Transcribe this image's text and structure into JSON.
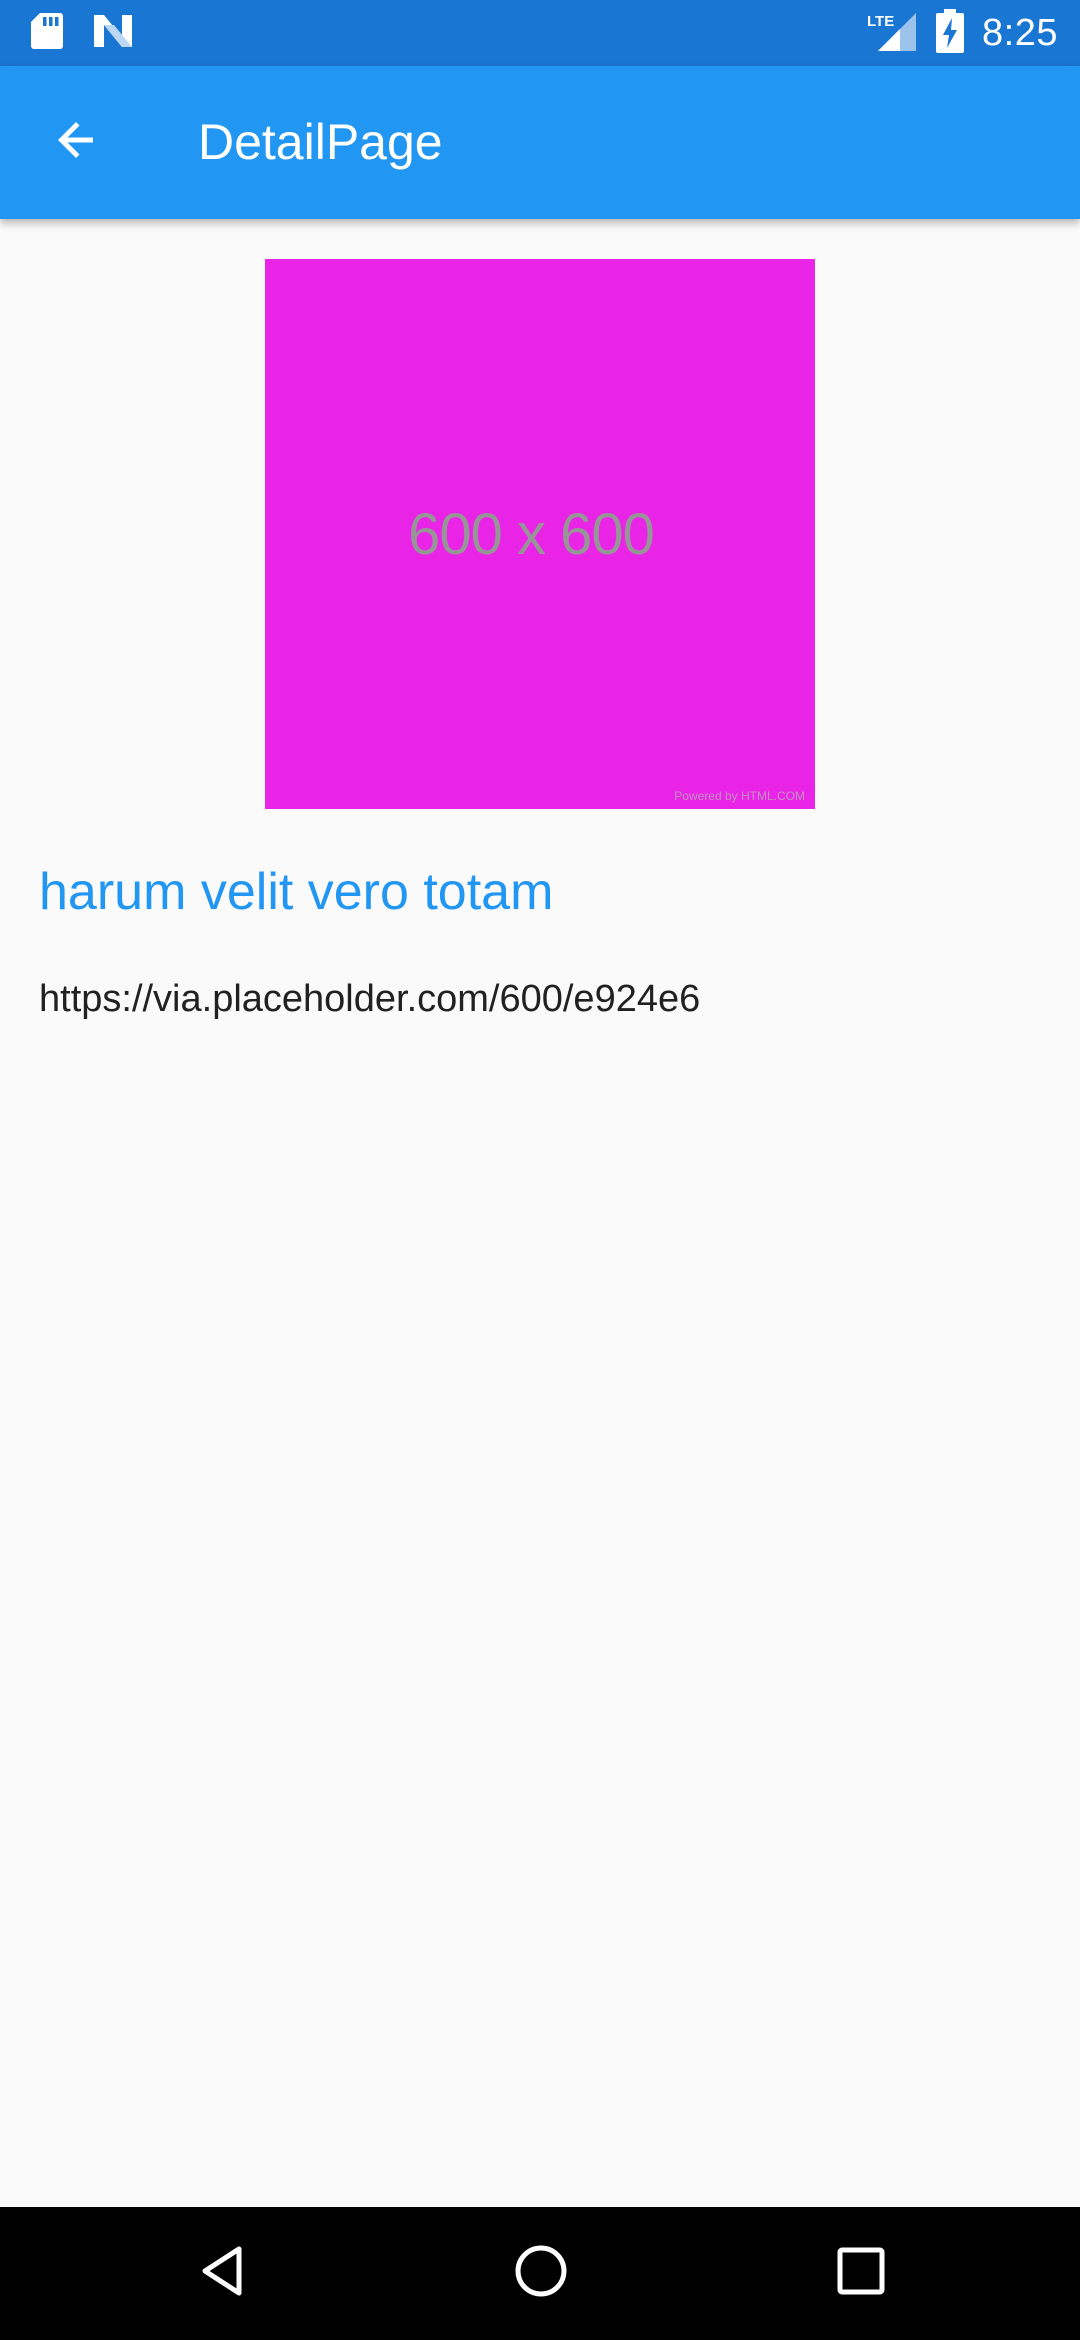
{
  "status_bar": {
    "time": "8:25",
    "network": "LTE",
    "icons": [
      "sd-card-icon",
      "n-notification-icon",
      "lte-signal-icon",
      "battery-charging-icon"
    ]
  },
  "app_bar": {
    "title": "DetailPage",
    "back_icon": "arrow-back-icon"
  },
  "detail": {
    "image": {
      "label": "600 x 600",
      "credit": "Powered by HTML.COM",
      "background": "#e924e6"
    },
    "title": "harum velit vero totam",
    "url": "https://via.placeholder.com/600/e924e6"
  },
  "nav_bar": {
    "buttons": [
      "back-triangle-icon",
      "home-circle-icon",
      "recents-square-icon"
    ]
  },
  "colors": {
    "status_bar": "#1976d2",
    "app_bar": "#2196f3",
    "accent_text": "#2196f3",
    "page_background": "#fafafa"
  }
}
